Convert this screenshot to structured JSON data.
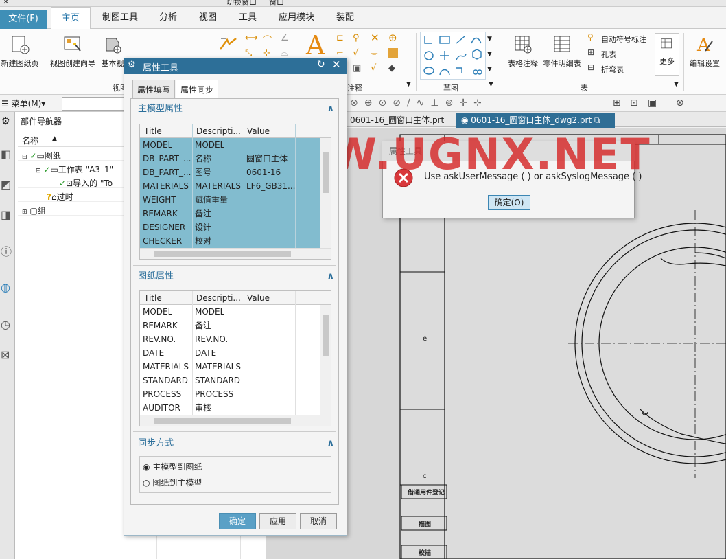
{
  "menu": {
    "file": "文件(F)",
    "tabs": [
      "主页",
      "制图工具",
      "分析",
      "视图",
      "工具",
      "应用模块",
      "装配"
    ]
  },
  "topbar": {
    "switch_window": "切换窗口",
    "window": "窗口"
  },
  "ribbon": {
    "new_sheet": "新建图纸页",
    "view_wizard": "视图创建向导",
    "base_view": "基本视",
    "group_view": "视图",
    "group_annot": "注释",
    "group_sketch": "草图",
    "group_table": "表",
    "table_note": "表格注释",
    "parts_list": "零件明细表",
    "auto_balloon": "自动符号标注",
    "hole_table": "孔表",
    "bend_table": "折弯表",
    "more": "更多",
    "edit_settings": "编辑设置"
  },
  "toolbar": {
    "menu_label": "菜单(M)",
    "menu_arrow": "▾"
  },
  "navigator": {
    "title": "部件导航器",
    "column_name": "名称",
    "sort_arrow": "▲",
    "tree": [
      {
        "label": "图纸"
      },
      {
        "label": "工作表 \"A3_1\""
      },
      {
        "label": "导入的 \"To"
      },
      {
        "label": "过时"
      },
      {
        "label": "组"
      }
    ]
  },
  "doc_tabs": [
    {
      "label": "0601-16_圆窗口主体.prt"
    },
    {
      "label": "0601-16_圆窗口主体_dwg2.prt"
    }
  ],
  "prop_dialog": {
    "title": "属性工具",
    "tab_fill": "属性填写",
    "tab_sync": "属性同步",
    "section_master": "主模型属性",
    "section_drawing": "图纸属性",
    "section_sync": "同步方式",
    "col_title": "Title",
    "col_desc": "Descripti...",
    "col_value": "Value",
    "master_rows": [
      {
        "title": "MODEL",
        "desc": "MODEL",
        "value": ""
      },
      {
        "title": "DB_PART_...",
        "desc": "名称",
        "value": "圆窗口主体"
      },
      {
        "title": "DB_PART_...",
        "desc": "图号",
        "value": "0601-16"
      },
      {
        "title": "MATERIALS",
        "desc": "MATERIALS",
        "value": "LF6_GB31..."
      },
      {
        "title": "WEIGHT",
        "desc": "赋值重量",
        "value": ""
      },
      {
        "title": "REMARK",
        "desc": "备注",
        "value": ""
      },
      {
        "title": "DESIGNER",
        "desc": "设计",
        "value": ""
      },
      {
        "title": "CHECKER",
        "desc": "校对",
        "value": ""
      }
    ],
    "drawing_rows": [
      {
        "title": "MODEL",
        "desc": "MODEL",
        "value": ""
      },
      {
        "title": "REMARK",
        "desc": "备注",
        "value": ""
      },
      {
        "title": "REV.NO.",
        "desc": "REV.NO.",
        "value": ""
      },
      {
        "title": "DATE",
        "desc": "DATE",
        "value": ""
      },
      {
        "title": "MATERIALS",
        "desc": "MATERIALS",
        "value": ""
      },
      {
        "title": "STANDARD",
        "desc": "STANDARD",
        "value": ""
      },
      {
        "title": "PROCESS",
        "desc": "PROCESS",
        "value": ""
      },
      {
        "title": "AUDITOR",
        "desc": "审核",
        "value": ""
      }
    ],
    "sync_options": [
      "主模型到图纸",
      "图纸到主模型"
    ],
    "sync_selected": 0,
    "ok": "确定",
    "apply": "应用",
    "cancel": "取消"
  },
  "message_dialog": {
    "title": "属性工具",
    "message": "Use askUserMessage ( ) or askSyslogMessage ( )",
    "ok": "确定(O)"
  },
  "drawing": {
    "block_labels": [
      "借通用件登记",
      "描图",
      "校描"
    ],
    "letter_c": "c",
    "letter_e": "e"
  },
  "watermark": "WWW.UGNX.NET",
  "colors": {
    "accent": "#2d6f98",
    "file_tab": "#3f8fb7",
    "selected_row": "#82bccf",
    "error_icon": "#d9373b",
    "watermark": "#d62828"
  }
}
